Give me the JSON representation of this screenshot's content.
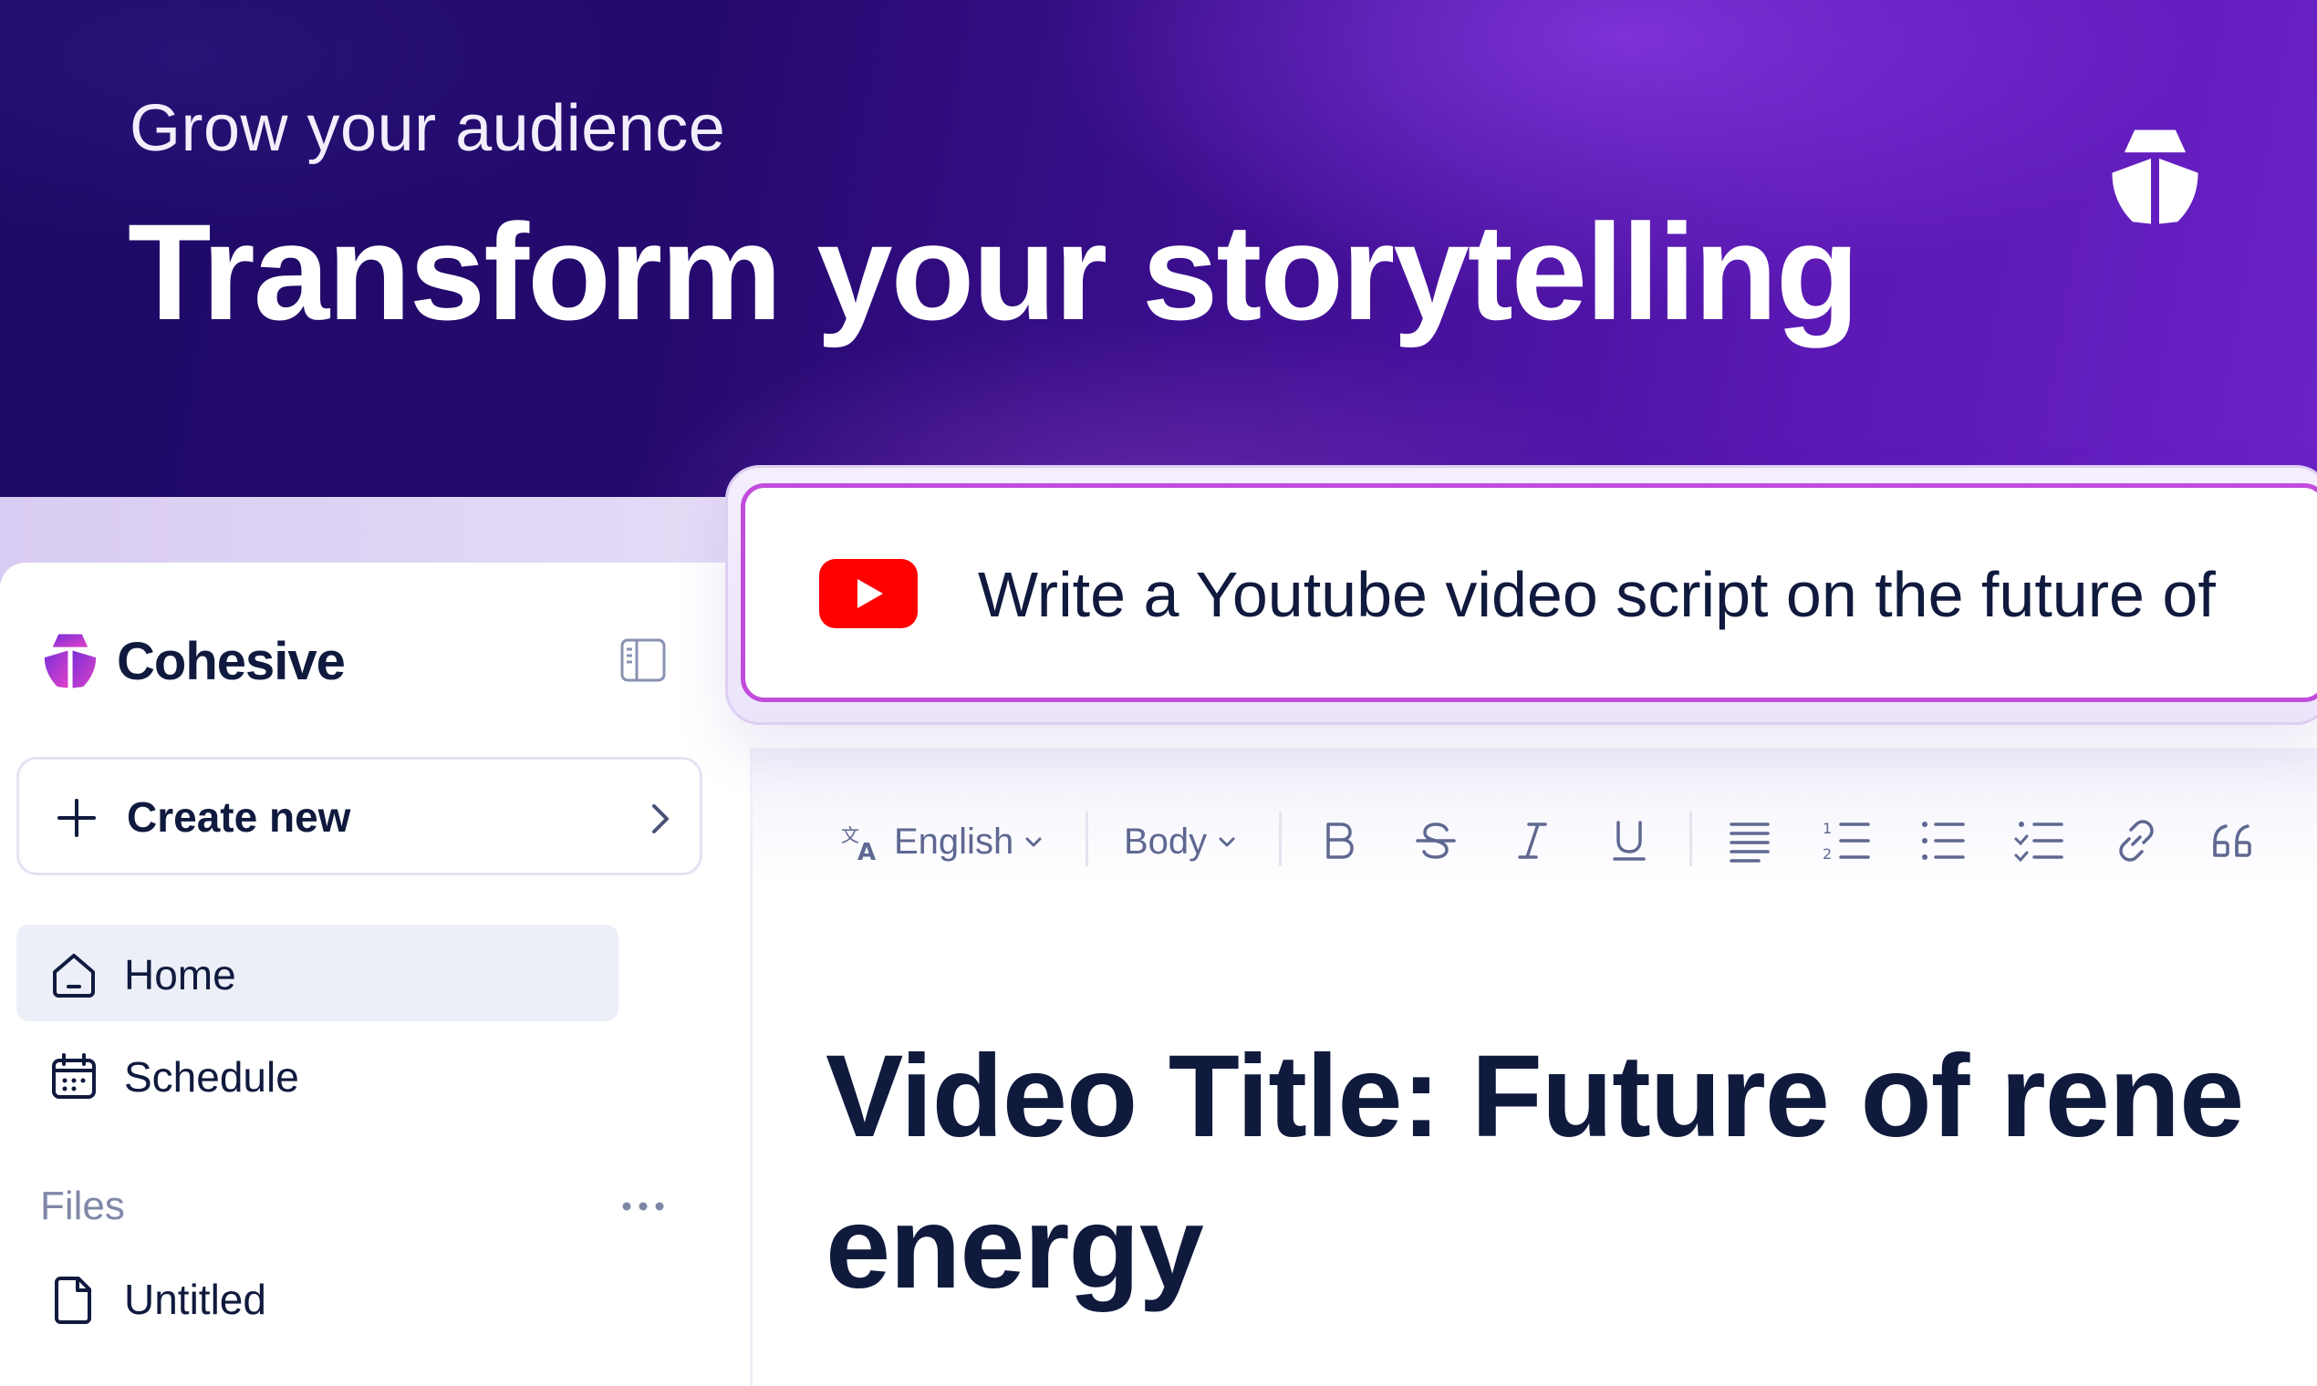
{
  "hero": {
    "subtitle": "Grow your audience",
    "title": "Transform your storytelling",
    "logo_icon": "cohesive-logo-icon"
  },
  "sidebar": {
    "brand": "Cohesive",
    "create_label": "Create new",
    "nav": [
      {
        "label": "Home",
        "icon": "home-icon",
        "active": true
      },
      {
        "label": "Schedule",
        "icon": "calendar-icon",
        "active": false
      }
    ],
    "files_label": "Files",
    "files": [
      {
        "label": "Untitled",
        "icon": "file-icon"
      }
    ]
  },
  "prompt": {
    "text": "Write a Youtube video script on the future of",
    "icon": "youtube-icon"
  },
  "toolbar": {
    "language": "English",
    "style": "Body",
    "buttons": [
      "bold-icon",
      "strikethrough-icon",
      "italic-icon",
      "underline-icon",
      "align-justify-icon",
      "numbered-list-icon",
      "bullet-list-icon",
      "checklist-icon",
      "link-icon",
      "quote-icon"
    ]
  },
  "document": {
    "title_line1": "Video Title: Future of rene",
    "title_line2": "energy"
  },
  "colors": {
    "accent": "#c14cdc",
    "text_dark": "#0f1a3d",
    "youtube_red": "#ff0000"
  }
}
